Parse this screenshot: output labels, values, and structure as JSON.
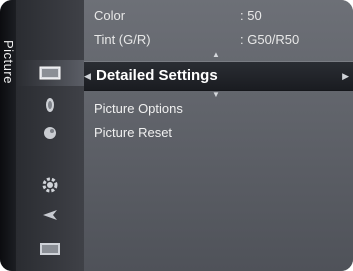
{
  "menu": {
    "section_tab": "Picture",
    "rows": [
      {
        "label": "Color",
        "value": ": 50"
      },
      {
        "label": "Tint (G/R)",
        "value": ": G50/R50"
      }
    ],
    "selected": {
      "label": "Detailed Settings"
    },
    "items": [
      {
        "label": "Picture Options"
      },
      {
        "label": "Picture Reset"
      }
    ]
  },
  "icons": [
    "picture-icon",
    "sound-icon",
    "satellite-icon",
    "settings-gear-icon",
    "input-icon",
    "application-icon"
  ],
  "colors": {
    "background": "#55585f",
    "highlight": "#1e2025",
    "text": "#e8e8e8"
  }
}
